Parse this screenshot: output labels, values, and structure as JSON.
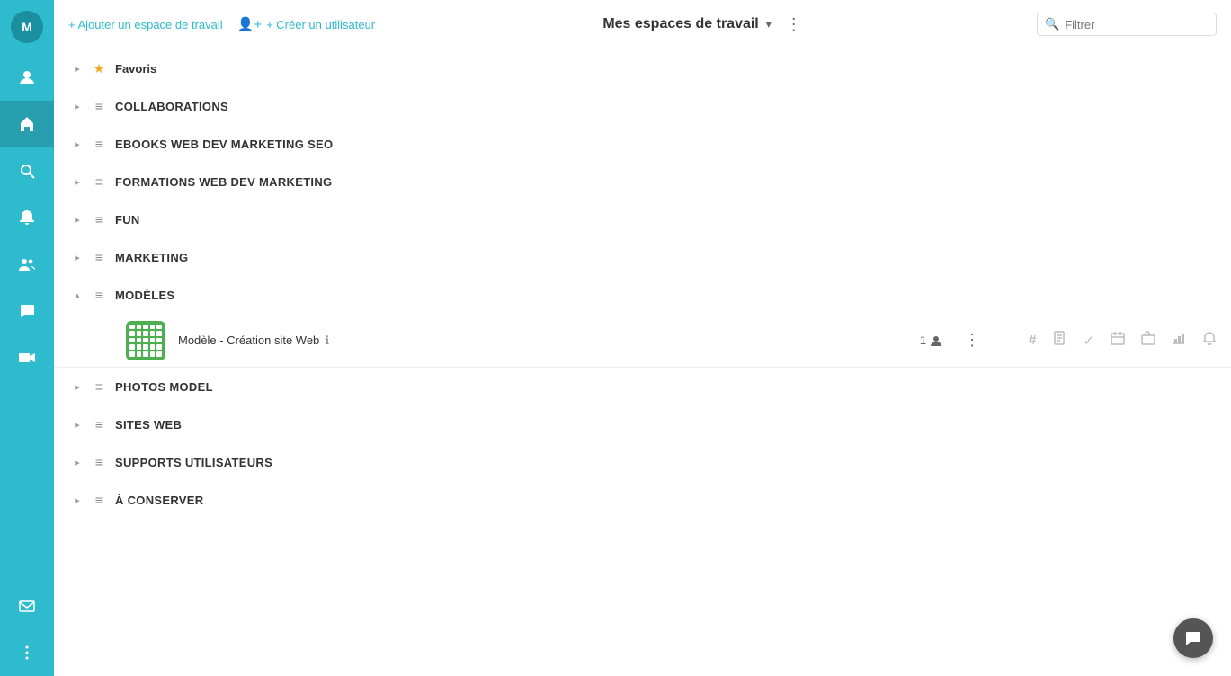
{
  "sidebar": {
    "avatar_initials": "M",
    "icons": [
      {
        "name": "user-icon",
        "symbol": "👤"
      },
      {
        "name": "home-icon",
        "symbol": "⌂"
      },
      {
        "name": "search-icon",
        "symbol": "🔍"
      },
      {
        "name": "bell-icon",
        "symbol": "🔔"
      },
      {
        "name": "contacts-icon",
        "symbol": "👥"
      },
      {
        "name": "chat-icon",
        "symbol": "💬"
      },
      {
        "name": "video-icon",
        "symbol": "📹"
      },
      {
        "name": "email-icon",
        "symbol": "✉"
      },
      {
        "name": "more-icon",
        "symbol": "⋮"
      }
    ]
  },
  "topbar": {
    "add_workspace_label": "+ Ajouter un espace de travail",
    "create_user_label": "+ Créer un utilisateur",
    "title": "Mes espaces de travail",
    "filter_placeholder": "Filtrer"
  },
  "list": {
    "items": [
      {
        "id": "favoris",
        "label": "Favoris",
        "icon": "star",
        "expanded": false,
        "chevron": "right"
      },
      {
        "id": "collaborations",
        "label": "COLLABORATIONS",
        "icon": "list",
        "expanded": false,
        "chevron": "right"
      },
      {
        "id": "ebooks",
        "label": "EBOOKS Web DeV Marketing SEO",
        "icon": "list",
        "expanded": false,
        "chevron": "right"
      },
      {
        "id": "formations",
        "label": "FORMATIONS Web Dev Marketing",
        "icon": "list",
        "expanded": false,
        "chevron": "right"
      },
      {
        "id": "fun",
        "label": "FUN",
        "icon": "list",
        "expanded": false,
        "chevron": "right"
      },
      {
        "id": "marketing",
        "label": "MARKETING",
        "icon": "list",
        "expanded": false,
        "chevron": "right"
      },
      {
        "id": "modeles",
        "label": "MODÈLES",
        "icon": "list",
        "expanded": true,
        "chevron": "down"
      },
      {
        "id": "photos",
        "label": "PHOTOS Model",
        "icon": "list",
        "expanded": false,
        "chevron": "right"
      },
      {
        "id": "sitesweb",
        "label": "SITES WEB",
        "icon": "list",
        "expanded": false,
        "chevron": "right"
      },
      {
        "id": "supports",
        "label": "SUPPORTS Utilisateurs",
        "icon": "list",
        "expanded": false,
        "chevron": "right"
      },
      {
        "id": "aconserver",
        "label": "À CONSERVER",
        "icon": "list",
        "expanded": false,
        "chevron": "right"
      }
    ]
  },
  "workspace": {
    "name": "Modèle - Création site Web",
    "member_count": "1",
    "action_icons": [
      {
        "name": "hashtag-icon",
        "symbol": "#"
      },
      {
        "name": "document-icon",
        "symbol": "📄"
      },
      {
        "name": "check-icon",
        "symbol": "✓"
      },
      {
        "name": "calendar-icon",
        "symbol": "📅"
      },
      {
        "name": "briefcase-icon",
        "symbol": "💼"
      },
      {
        "name": "chart-icon",
        "symbol": "📊"
      },
      {
        "name": "notification-icon",
        "symbol": "🔔"
      }
    ]
  },
  "chat_bubble": {
    "symbol": "💬"
  }
}
